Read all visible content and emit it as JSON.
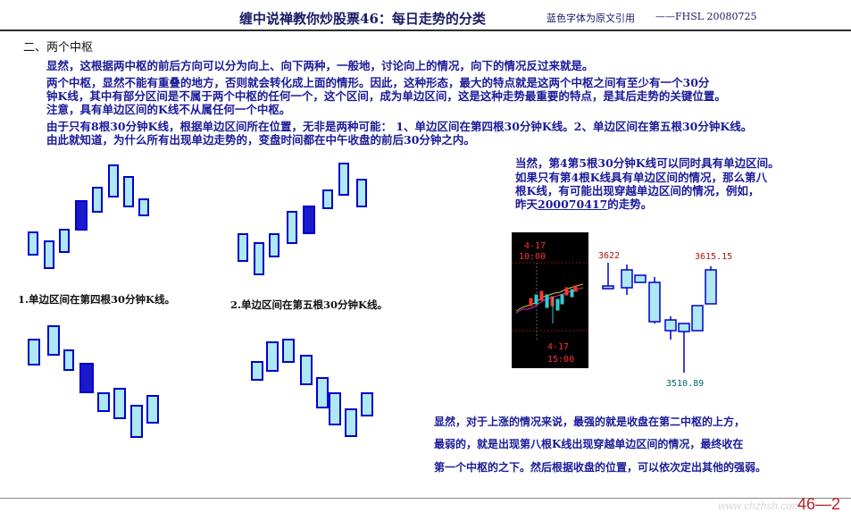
{
  "header": {
    "title": "缠中说禅教你炒股票46：每日走势的分类",
    "note": "蓝色字体为原文引用",
    "author": "——FHSL 20080725"
  },
  "section_title": "二、两个中枢",
  "paragraphs": [
    "显然，这根据两中枢的前后方向可以分为向上、向下两种，一般地，讨论向上的情况，向下的情况反过来就是。",
    "两个中枢，显然不能有重叠的地方，否则就会转化成上面的情形。因此，这种形态，最大的特点就是这两个中枢之间有至少有一个30分",
    "钟K线，其中有部分区间是不属于两个中枢的任何一个，这个区间，成为单边区间，这是这种走势最重要的特点，是其后走势的关键位置。",
    "注意，具有单边区间的K线不从属任何一个中枢。",
    "由于只有8根30分钟K线，根据单边区间所在位置，无非是两种可能： 1、单边区间在第四根30分钟K线。2、单边区间在第五根30分钟K线。",
    "由此就知道，为什么所有出现单边走势的，变盘时间都在中午收盘的前后30分钟之内。"
  ],
  "captions": {
    "left": "1.单边区间在第四根30分钟K线。",
    "right": "2.单边区间在第五根30分钟K线。"
  },
  "right_text": {
    "line1": "当然，第4第5根30分钟K线可以同时具有单边区间。",
    "line2": "如果只有第4根K线具有单边区间的情况，那么第八",
    "line3": "根K线，有可能出现穿越单边区间的情况，例如，",
    "line4_pre": "昨天",
    "line4_date": "200070417",
    "line4_post": "的走势。"
  },
  "chart_labels": {
    "date_top": "4-17",
    "time_top": "10:00",
    "date_bottom": "4-17",
    "time_bottom": "15:00",
    "price_high_left": "3622",
    "price_high_right": "3615.15",
    "price_low": "3510.89"
  },
  "bottom_text": {
    "line1": "显然，对于上涨的情况来说，最强的就是收盘在第二中枢的上方，",
    "line2": "最弱的，就是出现第八根K线出现穿越单边区间的情况，最终收在",
    "line3": "第一个中枢的之下。然后根据收盘的位置，可以依次定出其他的强弱。"
  },
  "page_number": "46—2",
  "watermark": "www.chzhsh.com",
  "colors": {
    "candle_fill": "#aee8f5",
    "candle_border": "#0000cc",
    "highlight_fill": "#1a1acc",
    "text_blue": "#1b1b99",
    "price_red": "#aa1111",
    "price_teal": "#006666"
  }
}
